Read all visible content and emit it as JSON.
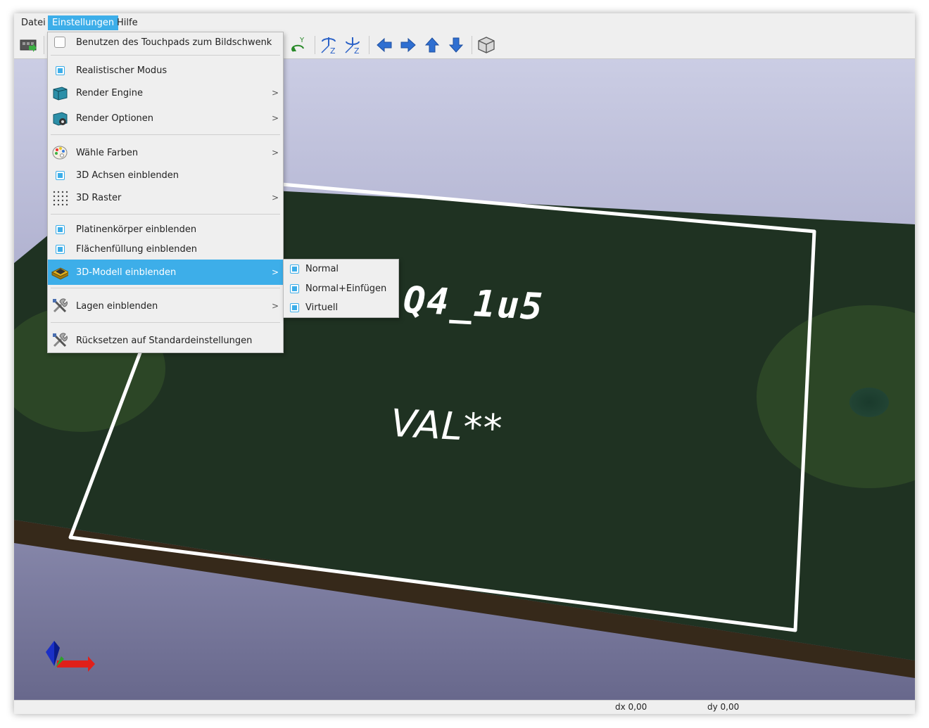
{
  "menubar": {
    "items": [
      "Datei",
      "Einstellungen",
      "Hilfe"
    ]
  },
  "settings_menu": {
    "touchpad": "Benutzen des Touchpads zum Bildschwenk",
    "realistic": "Realistischer Modus",
    "render_engine": "Render Engine",
    "render_options": "Render Optionen",
    "choose_colors": "Wähle Farben",
    "show_axes": "3D Achsen einblenden",
    "grid": "3D Raster",
    "show_board_body": "Platinenkörper einblenden",
    "show_zone_fill": "Flächenfüllung einblenden",
    "show_3d_models": "3D-Modell einblenden",
    "show_layers": "Lagen einblenden",
    "reset_defaults": "Rücksetzen auf Standardeinstellungen"
  },
  "submenu_3d_model": {
    "normal": "Normal",
    "normal_insert": "Normal+Einfügen",
    "virtual": "Virtuell"
  },
  "viewport": {
    "reference": "Q4_1u5",
    "value": "VAL**"
  },
  "status": {
    "dx": "dx 0,00",
    "dy": "dy 0,00"
  },
  "colors": {
    "accent": "#3daee9",
    "pcb": "#1f3222",
    "silk": "#ffffff",
    "bg_top": "#c9cbe3",
    "bg_bottom": "#6b6b8e"
  }
}
